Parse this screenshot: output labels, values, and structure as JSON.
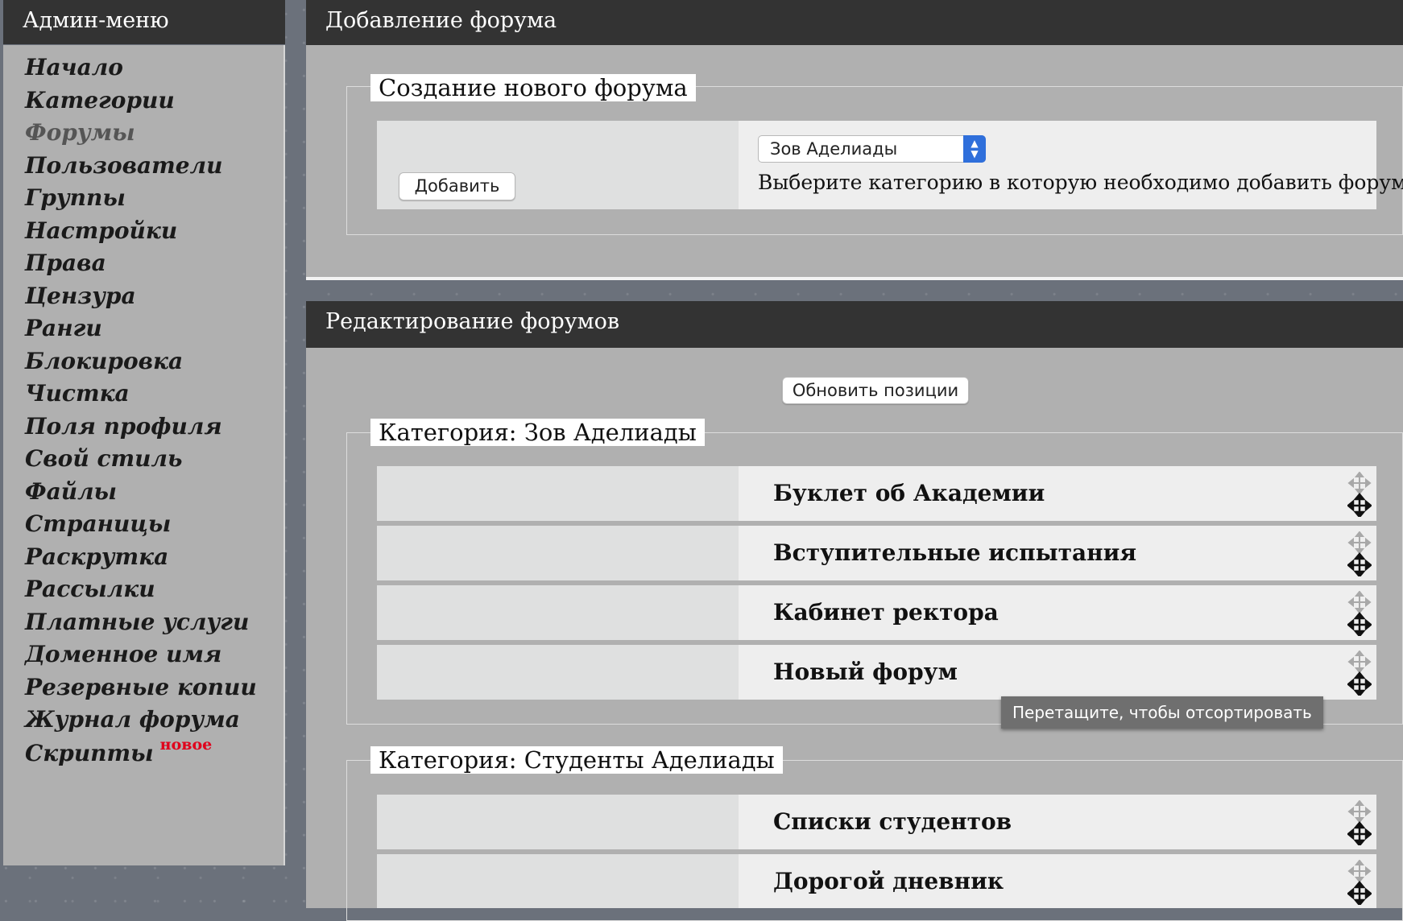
{
  "sidebar": {
    "title": "Админ-меню",
    "items": [
      {
        "label": "Начало"
      },
      {
        "label": "Категории"
      },
      {
        "label": "Форумы"
      },
      {
        "label": "Пользователи"
      },
      {
        "label": "Группы"
      },
      {
        "label": "Настройки"
      },
      {
        "label": "Права"
      },
      {
        "label": "Цензура"
      },
      {
        "label": "Ранги"
      },
      {
        "label": "Блокировка"
      },
      {
        "label": "Чистка"
      },
      {
        "label": "Поля профиля"
      },
      {
        "label": "Свой стиль"
      },
      {
        "label": "Файлы"
      },
      {
        "label": "Страницы"
      },
      {
        "label": "Раскрутка"
      },
      {
        "label": "Рассылки"
      },
      {
        "label": "Платные услуги"
      },
      {
        "label": "Доменное имя"
      },
      {
        "label": "Резервные копии"
      },
      {
        "label": "Журнал форума"
      },
      {
        "label": "Скрипты",
        "badge": "новое"
      }
    ],
    "active_item": "Форумы"
  },
  "add_panel": {
    "title": "Добавление форума",
    "legend": "Создание нового форума",
    "add_button": "Добавить",
    "category_select": "Зов Аделиады",
    "hint": "Выберите категорию в которую необходимо добавить форум."
  },
  "edit_panel": {
    "title": "Редактирование форумов",
    "update_button": "Обновить позиции",
    "categories": [
      {
        "legend": "Категория: Зов Аделиады",
        "forums": [
          "Буклет об Академии",
          "Вступительные испытания",
          "Кабинет ректора",
          "Новый форум"
        ]
      },
      {
        "legend": "Категория: Студенты Аделиады",
        "forums": [
          "Списки студентов",
          "Дорогой дневник"
        ]
      }
    ],
    "tooltip": "Перетащите, чтобы отсортировать"
  },
  "colors": {
    "header_bg": "#333333",
    "panel_bg": "#b0b0b0",
    "badge": "#e0001b",
    "select_arrow": "#2f6fdb"
  },
  "icons": {
    "drag_handle": "move-arrows-icon",
    "select_arrow": "chevron-up-down-icon"
  }
}
